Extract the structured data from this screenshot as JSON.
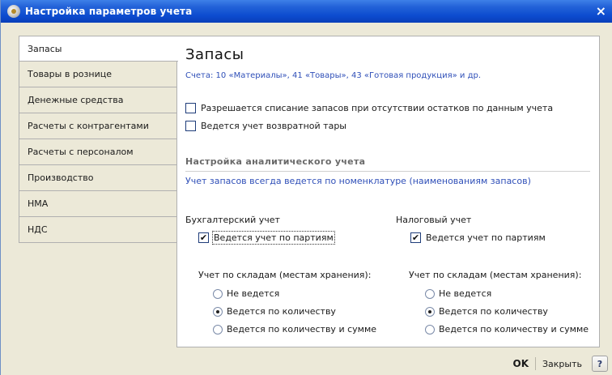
{
  "window": {
    "title": "Настройка параметров учета",
    "close_glyph": "×"
  },
  "tabs": [
    {
      "label": "Запасы",
      "active": true
    },
    {
      "label": "Товары в рознице"
    },
    {
      "label": "Денежные средства"
    },
    {
      "label": "Расчеты с контрагентами"
    },
    {
      "label": "Расчеты с персоналом"
    },
    {
      "label": "Производство"
    },
    {
      "label": "НМА"
    },
    {
      "label": "НДС"
    }
  ],
  "panel": {
    "title": "Запасы",
    "accounts_line": "Счета: 10 «Материалы», 41 «Товары», 43 «Готовая продукция» и др.",
    "options": [
      {
        "label": "Разрешается списание запасов при отсутствии остатков по данным учета",
        "checked": false
      },
      {
        "label": "Ведется учет возвратной тары",
        "checked": false
      }
    ],
    "analytics_title": "Настройка аналитического учета",
    "analytics_note": "Учет запасов всегда ведется по номенклатуре (наименованиям запасов)",
    "accounting": {
      "title": "Бухгалтерский учет",
      "batches_label": "Ведется учет по партиям",
      "batches_checked": true,
      "warehouses_title": "Учет по складам (местам хранения):",
      "radios": [
        "Не ведется",
        "Ведется по количеству",
        "Ведется по количеству и сумме"
      ],
      "selected": 1
    },
    "tax": {
      "title": "Налоговый учет",
      "batches_label": "Ведется учет по партиям",
      "batches_checked": true,
      "warehouses_title": "Учет по складам (местам хранения):",
      "radios": [
        "Не ведется",
        "Ведется по количеству",
        "Ведется по количеству и сумме"
      ],
      "selected": 1
    }
  },
  "footer": {
    "ok_label": "OK",
    "close_label": "Закрыть",
    "help_label": "?"
  },
  "check_glyph": "✔",
  "colors": {
    "titlebar": "#0c4bcf",
    "link_text": "#2f4fb8",
    "window_bg": "#ece9d8"
  }
}
